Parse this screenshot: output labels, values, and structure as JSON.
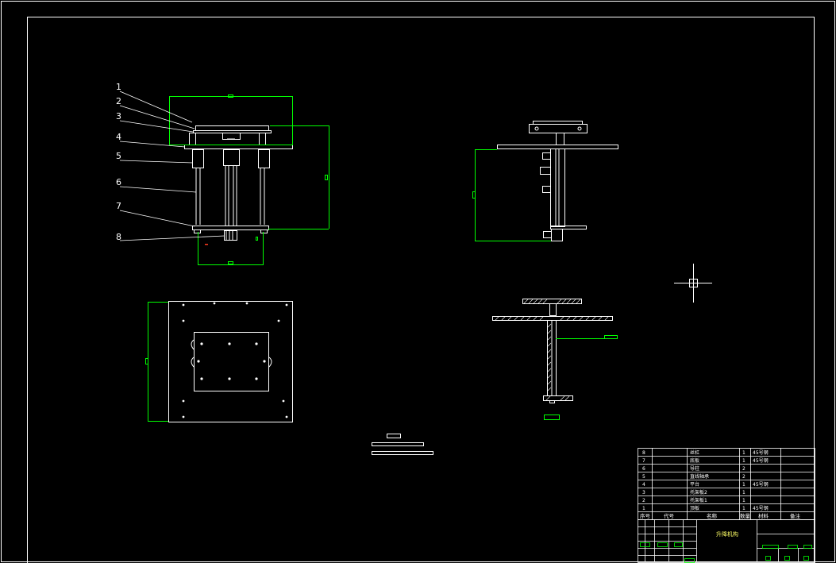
{
  "colors": {
    "background": "#000000",
    "linework": "#ffffff",
    "dimension": "#00ff00",
    "accent": "#ffff66",
    "marker": "#ff3b1f"
  },
  "callouts": [
    "1",
    "2",
    "3",
    "4",
    "5",
    "6",
    "7",
    "8"
  ],
  "parts_list": {
    "rows": [
      {
        "no": "8",
        "name": "丝杠",
        "qty": "1",
        "material": "45号钢"
      },
      {
        "no": "7",
        "name": "底板",
        "qty": "1",
        "material": "45号钢"
      },
      {
        "no": "6",
        "name": "导柱",
        "qty": "2",
        "material": ""
      },
      {
        "no": "5",
        "name": "直线轴承",
        "qty": "2",
        "material": ""
      },
      {
        "no": "4",
        "name": "平台",
        "qty": "1",
        "material": "45号钢"
      },
      {
        "no": "3",
        "name": "托架板2",
        "qty": "1",
        "material": ""
      },
      {
        "no": "2",
        "name": "托架板1",
        "qty": "1",
        "material": ""
      },
      {
        "no": "1",
        "name": "顶板",
        "qty": "1",
        "material": "45号钢"
      }
    ],
    "header": {
      "no": "序号",
      "code": "代号",
      "name": "名称",
      "qty": "数量",
      "material": "材料",
      "note": "备注"
    }
  },
  "title_block": {
    "drawing_title": "升降机构"
  },
  "crosshair_icon": "crosshair-cursor-icon"
}
